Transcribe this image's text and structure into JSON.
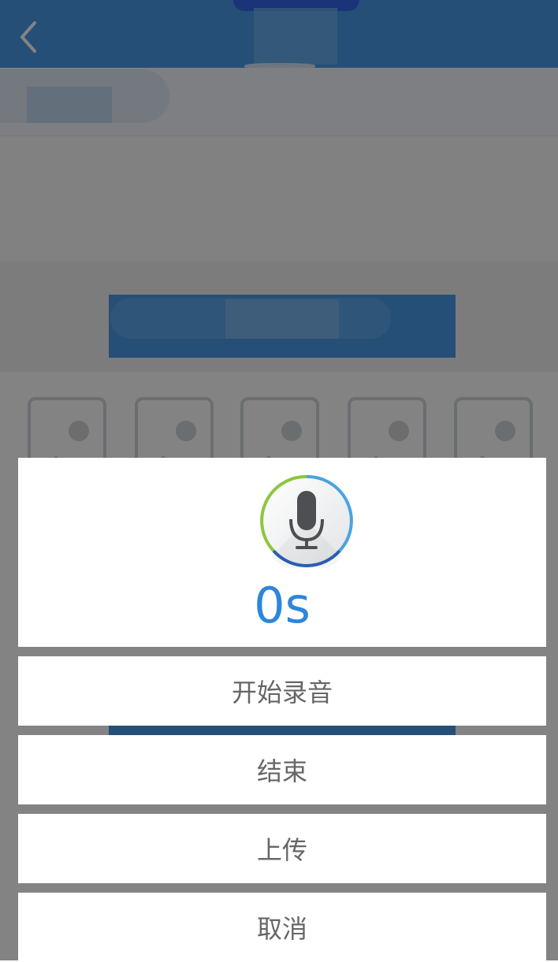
{
  "header": {
    "back_icon": "chevron-left-icon",
    "accent": "#2f8de3"
  },
  "dialog": {
    "icon": "microphone-icon",
    "timer": "0s",
    "timer_color": "#2e86d9",
    "buttons": {
      "start_record": "开始录音",
      "stop": "结束",
      "upload": "上传",
      "cancel": "取消"
    }
  }
}
